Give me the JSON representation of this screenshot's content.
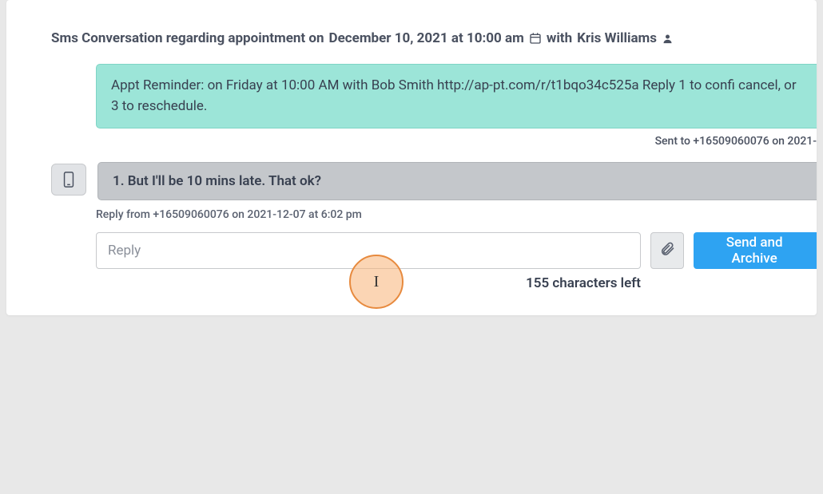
{
  "header": {
    "prefix": "Sms Conversation regarding appointment on",
    "date": "December 10, 2021 at 10:00 am",
    "with_label": "with",
    "person": "Kris Williams"
  },
  "outgoing": {
    "text": "Appt Reminder: on Friday at 10:00 AM with Bob Smith http://ap-pt.com/r/t1bqo34c525a Reply 1 to confi cancel, or 3 to reschedule.",
    "meta": "Sent to +16509060076 on 2021-"
  },
  "incoming": {
    "text": "1. But I'll be 10 mins late. That ok?",
    "meta": "Reply from +16509060076 on 2021-12-07 at 6:02 pm"
  },
  "reply": {
    "placeholder": "Reply",
    "char_counter": "155 characters left",
    "send_label": "Send and Archive"
  }
}
